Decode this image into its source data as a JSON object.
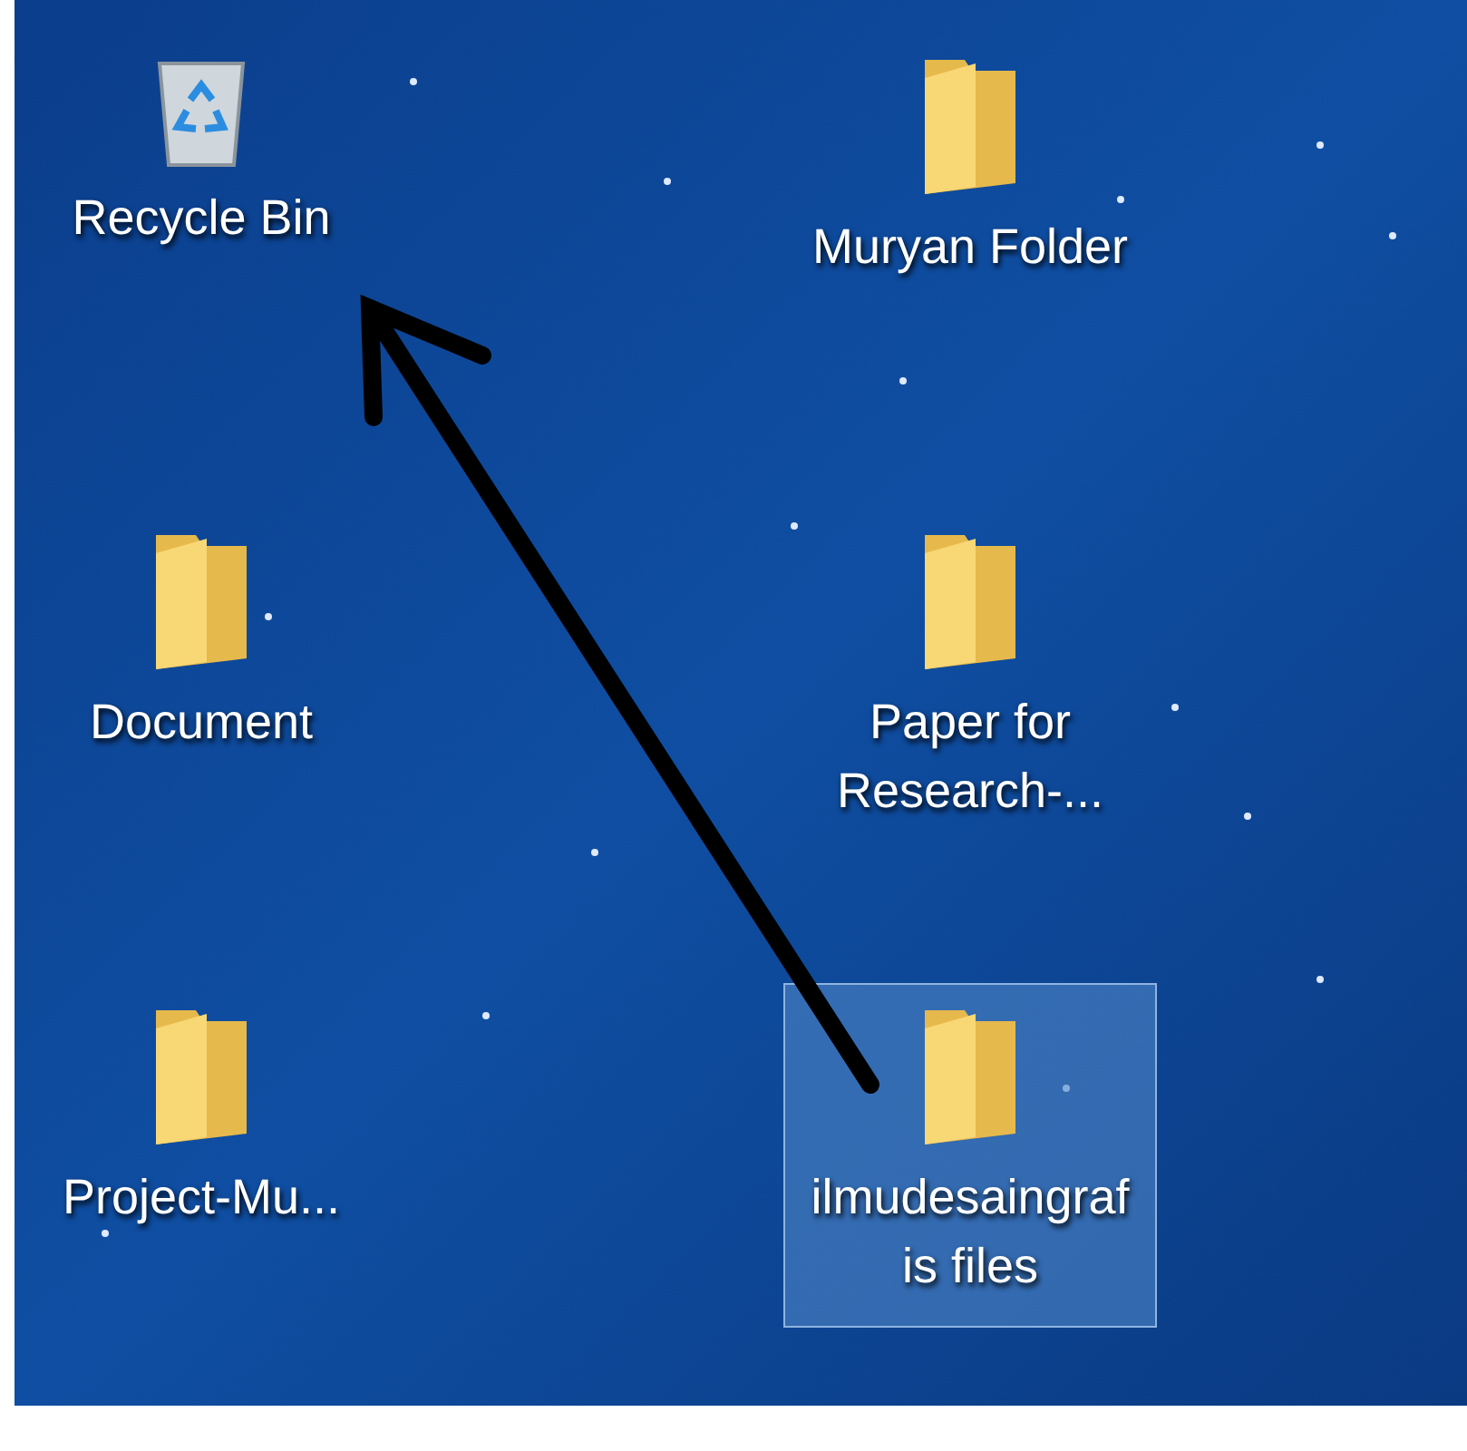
{
  "desktop": {
    "icons": [
      {
        "kind": "recycle_bin",
        "label": "Recycle Bin",
        "selected": false
      },
      {
        "kind": "folder",
        "label": "Muryan Folder",
        "selected": false
      },
      {
        "kind": "folder",
        "label": "Document",
        "selected": false
      },
      {
        "kind": "folder",
        "label": "Paper for Research-...",
        "selected": false
      },
      {
        "kind": "folder",
        "label": "Project-Mu...",
        "selected": false
      },
      {
        "kind": "folder",
        "label": "ilmudesaingrafis files",
        "selected": true
      }
    ]
  }
}
